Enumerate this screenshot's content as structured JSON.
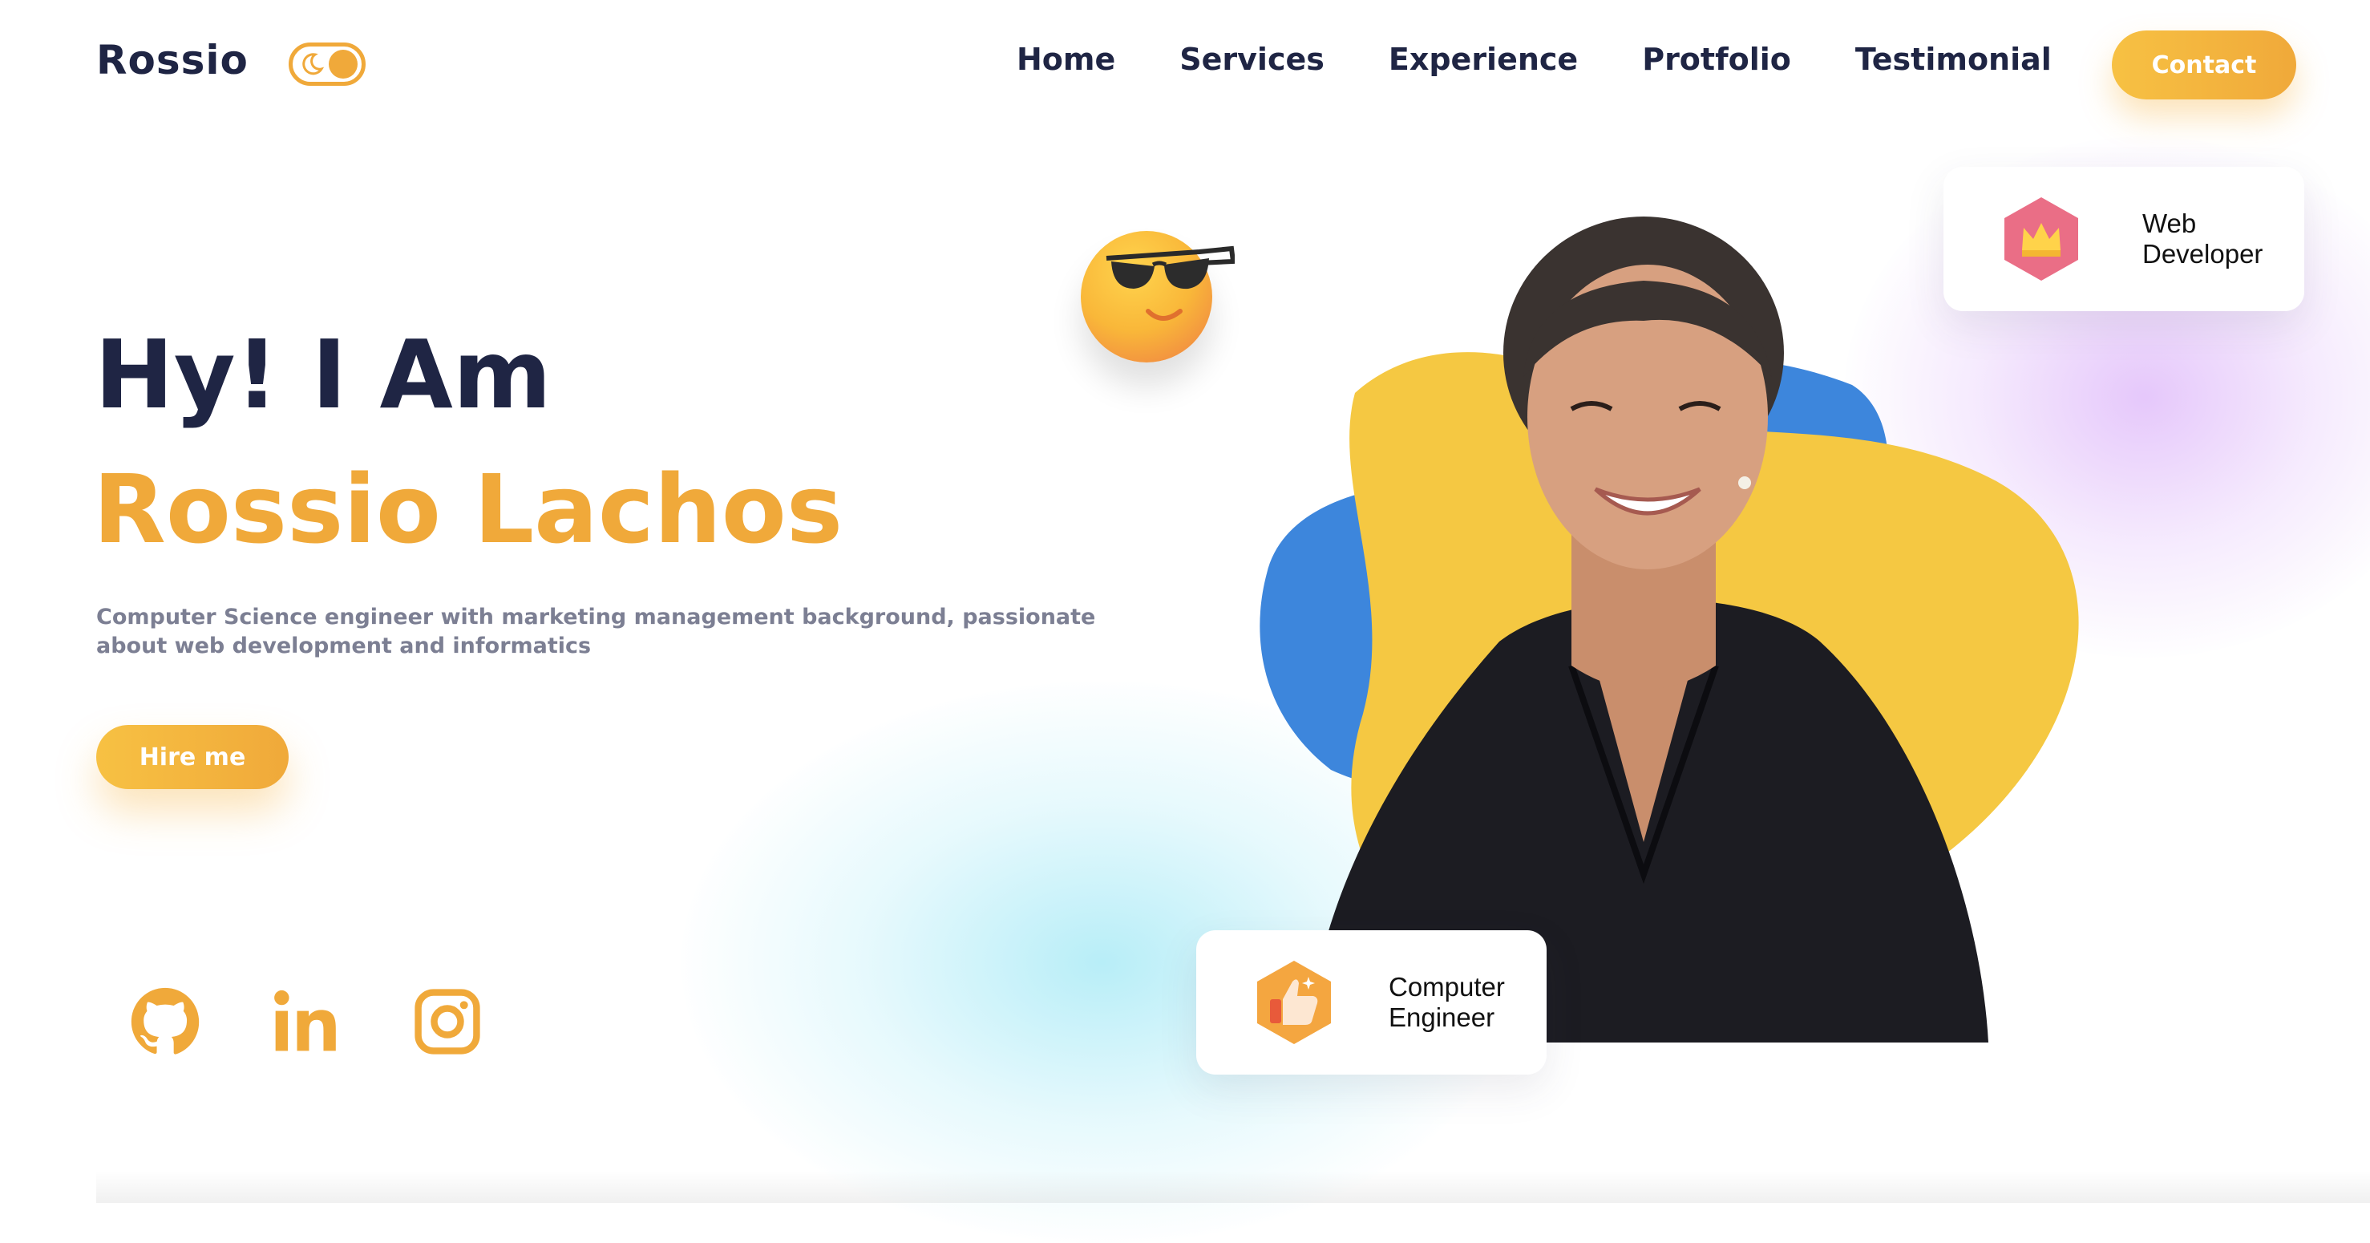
{
  "header": {
    "logo": "Rossio",
    "nav": [
      "Home",
      "Services",
      "Experience",
      "Protfolio",
      "Testimonial"
    ],
    "contact_label": "Contact"
  },
  "hero": {
    "greeting": "Hy! I Am",
    "name": "Rossio Lachos",
    "description": "Computer Science engineer with marketing management background, passionate about web development and informatics",
    "hire_label": "Hire me"
  },
  "badges": {
    "web_line1": "Web",
    "web_line2": "Developer",
    "eng_line1": "Computer",
    "eng_line2": "Engineer"
  },
  "socials": [
    "github-icon",
    "linkedin-icon",
    "instagram-icon"
  ],
  "colors": {
    "accent": "#f0a93a",
    "accent_light": "#f7c143",
    "text_dark": "#1f2544",
    "text_muted": "#7c7f93",
    "blob_yellow": "#f5c842",
    "blob_blue": "#3d86dc"
  }
}
